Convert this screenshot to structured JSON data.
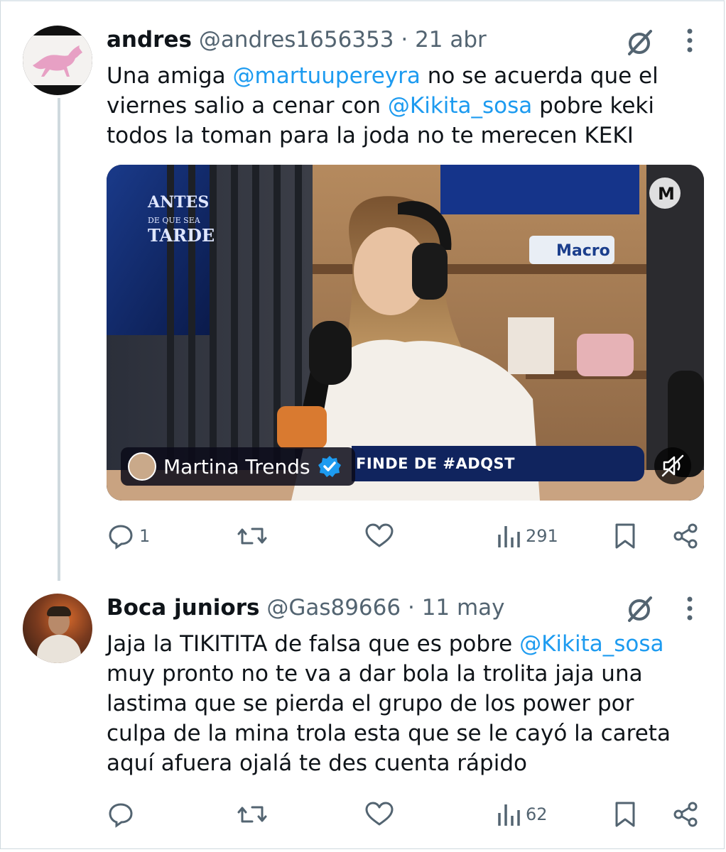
{
  "colors": {
    "text": "#0f1419",
    "secondary": "#536471",
    "link": "#1d9bf0",
    "thread_line": "#cfd9de",
    "verified": "#1d9bf0"
  },
  "tweets": [
    {
      "author_name": "andres",
      "handle": "@andres1656353",
      "separator": "·",
      "date": "21 abr",
      "text_parts": [
        "Una amiga ",
        "@martuupereyra",
        " no se acuerda que el viernes salio a cenar con ",
        "@Kikita_sosa",
        "  pobre keki todos la toman para la joda no te merecen KEKI"
      ],
      "media": {
        "overlay_name": "Martina Trends",
        "ticker_text": "FINDE DE #ADQST",
        "show_logo": "ANTES DE QUE SEA TARDE",
        "brand_sign": "Macro",
        "channel_logo": "M"
      },
      "stats": {
        "replies": "1",
        "retweets": "",
        "likes": "",
        "views": "291"
      }
    },
    {
      "author_name": "Boca juniors",
      "handle": "@Gas89666",
      "separator": "·",
      "date": "11 may",
      "text_parts": [
        "Jaja la TIKITITA de falsa que es pobre ",
        "@Kikita_sosa",
        " muy pronto no te va a dar bola la trolita jaja una lastima que se pierda el grupo de los power por culpa de la mina trola esta que se le cayó la careta aquí afuera ojalá te des cuenta rápido"
      ],
      "stats": {
        "replies": "",
        "retweets": "",
        "likes": "",
        "views": "62"
      }
    }
  ],
  "icons": [
    "grok-icon",
    "more-icon",
    "reply-icon",
    "retweet-icon",
    "like-icon",
    "views-icon",
    "bookmark-icon",
    "share-icon",
    "mute-icon",
    "verified-badge-icon"
  ]
}
